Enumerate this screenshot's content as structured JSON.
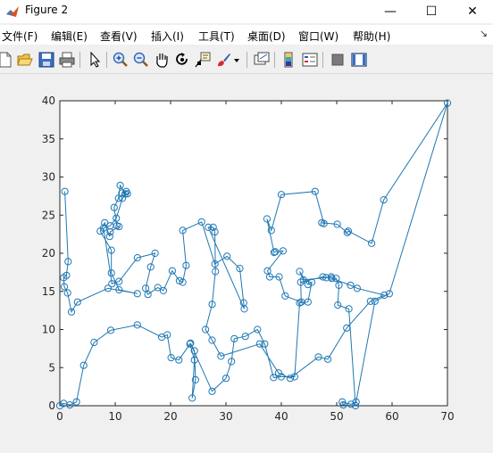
{
  "window": {
    "title": "Figure 2"
  },
  "window_controls": {
    "minimize": "—",
    "maximize": "☐",
    "close": "✕"
  },
  "menu": {
    "items": [
      "文件(F)",
      "编辑(E)",
      "查看(V)",
      "插入(I)",
      "工具(T)",
      "桌面(D)",
      "窗口(W)",
      "帮助(H)"
    ],
    "overflow_icon": "arrow-icon"
  },
  "toolbar": {
    "icons": [
      "new-figure-icon",
      "open-file-icon",
      "save-icon",
      "print-icon",
      "edit-plot-icon",
      "zoom-in-icon",
      "zoom-out-icon",
      "pan-icon",
      "rotate-3d-icon",
      "data-cursor-icon",
      "brush-icon",
      "dropdown-arrow-icon",
      "link-plot-icon",
      "insert-colorbar-icon",
      "insert-legend-icon",
      "hide-plot-tools-icon",
      "show-plot-tools-icon"
    ]
  },
  "colors": {
    "line": "#1f77b4",
    "axes": "#262626"
  },
  "chart_data": {
    "type": "line",
    "xlim": [
      0,
      70
    ],
    "ylim": [
      0,
      40
    ],
    "xticks": [
      0,
      10,
      20,
      30,
      40,
      50,
      60,
      70
    ],
    "yticks": [
      0,
      5,
      10,
      15,
      20,
      25,
      30,
      35,
      40
    ],
    "marker": "o",
    "grid": false,
    "x": [
      0,
      0.7,
      1.8,
      3.0,
      4.3,
      6.2,
      9.2,
      14.0,
      18.4,
      19.4,
      20.1,
      21.5,
      23.5,
      24.3,
      23.9,
      24.5,
      24.3,
      23.6,
      27.5,
      30.0,
      31.0,
      31.5,
      33.5,
      35.7,
      37.0,
      38.6,
      40.0,
      42.4,
      43.3,
      44.8,
      45.5,
      44.8,
      43.3,
      44.0,
      48.1,
      49.0,
      49.9,
      50.4,
      50.2,
      52.2,
      53.4,
      51.2,
      51.0,
      52.6,
      53.5,
      56.9,
      59.5,
      70.0,
      58.5,
      56.3,
      52.1,
      51.9,
      50.1,
      47.3,
      47.7,
      46.1,
      40.0,
      38.2,
      37.4,
      38.7,
      38.9,
      40.3,
      37.5,
      37.9,
      39.6,
      40.7,
      43.6,
      43.5,
      47.5,
      49.1,
      52.5,
      53.7,
      58.6,
      56.1,
      51.8,
      48.4,
      46.7,
      41.6,
      39.5,
      36.1,
      29.1,
      27.5,
      26.3,
      27.5,
      28.1,
      28.0,
      27.7,
      26.8,
      33.3,
      33.2,
      32.5,
      30.2,
      28.0,
      25.6,
      22.2,
      22.8,
      22.2,
      21.6,
      20.3,
      18.7,
      17.7,
      15.9,
      15.5,
      16.4,
      17.2,
      14.0,
      10.7,
      9.4,
      7.9,
      9.1,
      10.2,
      11.3,
      12.2,
      11.2,
      12.0,
      11.8,
      10.9,
      10.6,
      9.8,
      10.3,
      10.7,
      9.1,
      9.0,
      8.1,
      7.3,
      9.3,
      9.3,
      10.7,
      14.0,
      8.7,
      3.2,
      2.1,
      1.4,
      0.8,
      0.7,
      1.2,
      1.5,
      0.9
    ],
    "y": [
      0,
      0.3,
      0.1,
      0.5,
      5.3,
      8.3,
      9.9,
      10.6,
      9.0,
      9.3,
      6.3,
      6.0,
      8.1,
      6.0,
      1.0,
      3.4,
      7.2,
      8.2,
      1.9,
      3.6,
      5.8,
      8.8,
      9.1,
      10.0,
      8.1,
      3.7,
      3.8,
      3.8,
      13.5,
      13.6,
      16.2,
      15.9,
      17.6,
      16.5,
      16.8,
      16.9,
      16.7,
      15.8,
      13.2,
      12.7,
      0.0,
      0.1,
      0.5,
      0.2,
      0.5,
      13.7,
      14.7,
      39.7,
      27.0,
      21.3,
      22.9,
      22.7,
      23.8,
      24.0,
      23.9,
      28.1,
      27.7,
      23.0,
      24.5,
      20.1,
      20.2,
      20.3,
      17.7,
      16.9,
      16.9,
      14.4,
      13.6,
      16.2,
      16.9,
      16.7,
      15.8,
      15.4,
      14.5,
      13.7,
      10.2,
      6.1,
      6.4,
      3.6,
      4.3,
      8.1,
      6.5,
      8.6,
      10.0,
      13.3,
      17.6,
      22.8,
      23.4,
      23.4,
      12.7,
      13.5,
      18.0,
      19.6,
      18.6,
      24.1,
      23.0,
      18.4,
      16.2,
      16.4,
      17.7,
      15.1,
      15.5,
      14.6,
      15.4,
      18.2,
      20.0,
      19.4,
      16.3,
      16.0,
      23.3,
      23.6,
      24.6,
      27.2,
      27.8,
      27.9,
      28.1,
      27.8,
      28.9,
      27.2,
      26.0,
      23.6,
      23.5,
      22.8,
      22.2,
      24.0,
      22.9,
      20.4,
      17.4,
      15.2,
      14.7,
      15.4,
      13.6,
      12.3,
      14.8,
      15.6,
      16.8,
      17.1,
      18.9,
      28.1,
      28.0,
      28.1
    ]
  }
}
